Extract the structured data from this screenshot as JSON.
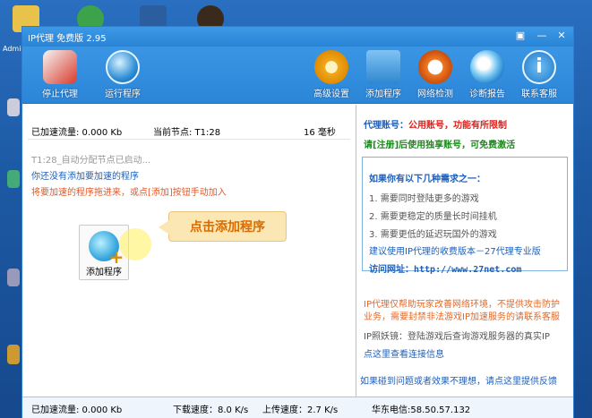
{
  "window": {
    "title": "IP代理 免费版 2.95"
  },
  "desktop": {
    "label": "Admi"
  },
  "toolbar": [
    {
      "label": "停止代理",
      "icon": "rocket-icon"
    },
    {
      "label": "运行程序",
      "icon": "globe-icon"
    },
    {
      "label": "高级设置",
      "icon": "gear-icon"
    },
    {
      "label": "添加程序",
      "icon": "add-folder-icon"
    },
    {
      "label": "网络检测",
      "icon": "speedometer-icon"
    },
    {
      "label": "诊断报告",
      "icon": "magnifier-icon"
    },
    {
      "label": "联系客服",
      "icon": "info-icon"
    }
  ],
  "stats": {
    "accel_flow": "已加速流量:  0.000 Kb",
    "node": "当前节点:  T1:28",
    "latency": "16 毫秒"
  },
  "messages": {
    "auto_node": "T1:28_自动分配节点已启动...",
    "no_program": "你还没有添加要加速的程序",
    "hint": "将要加速的程序拖进来，或点[添加]按钮手动加入"
  },
  "add_button": {
    "label": "添加程序"
  },
  "callout": {
    "text": "点击添加程序"
  },
  "side": {
    "account_label": "代理账号：",
    "account_value": "公用账号，功能有所限制",
    "register": "请[注册]后使用独享账号，可免费激活",
    "needs_title": "如果你有以下几种需求之一：",
    "needs": [
      "1.  需要同时登陆更多的游戏",
      "2.  需要更稳定的质量长时间挂机",
      "3.  需要更低的延迟玩国外的游戏"
    ],
    "suggest": "建议使用IP代理的收费版本－27代理专业版",
    "visit_label": "访问网址：",
    "visit_url": "http://www.27net.com",
    "notice": "IP代理仅帮助玩家改善网络环境，不提供攻击防护业务，需要封禁非法游戏IP加速服务的请联系客服",
    "ip_note": "IP照妖镜：登陆游戏后查询游戏服务器的真实IP",
    "conn_info": "点这里查看连接信息",
    "problem": "如果碰到问题或者效果不理想，请点这里提供反馈"
  },
  "statusbar": {
    "accel": "已加速流量: 0.000 Kb",
    "download": "下载速度：8.0 K/s",
    "upload": "上传速度：2.7 K/s",
    "telecom": "华东电信:58.50.57.132"
  }
}
